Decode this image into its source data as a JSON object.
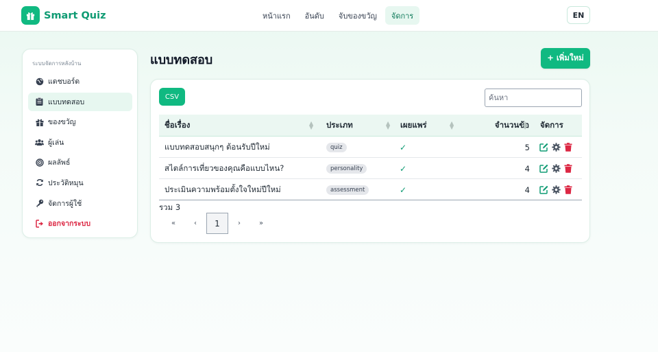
{
  "app": {
    "name": "Smart Quiz"
  },
  "topnav": [
    {
      "label": "หน้าแรก",
      "active": false
    },
    {
      "label": "อันดับ",
      "active": false
    },
    {
      "label": "จับของขวัญ",
      "active": false
    },
    {
      "label": "จัดการ",
      "active": true
    }
  ],
  "lang_button": "EN",
  "sidebar": {
    "heading": "ระบบจัดการหลังบ้าน",
    "items": [
      {
        "label": "แดชบอร์ด",
        "icon": "globe-icon",
        "active": false
      },
      {
        "label": "แบบทดสอบ",
        "icon": "clipboard-icon",
        "active": true
      },
      {
        "label": "ของขวัญ",
        "icon": "gift-icon",
        "active": false
      },
      {
        "label": "ผู้เล่น",
        "icon": "users-icon",
        "active": false
      },
      {
        "label": "ผลลัพธ์",
        "icon": "target-icon",
        "active": false
      },
      {
        "label": "ประวัติหมุน",
        "icon": "refresh-icon",
        "active": false
      },
      {
        "label": "จัดการผู้ใช้",
        "icon": "key-icon",
        "active": false
      },
      {
        "label": "ออกจากระบบ",
        "icon": "logout-icon",
        "active": false
      }
    ]
  },
  "page": {
    "title": "แบบทดสอบ",
    "add_button": "+ เพิ่มใหม่",
    "csv_button": "CSV",
    "search_placeholder": "ค้นหา"
  },
  "table": {
    "columns": [
      "ชื่อเรื่อง",
      "ประเภท",
      "เผยแพร่",
      "จำนวนข้อ",
      "จัดการ"
    ],
    "rows": [
      {
        "title": "แบบทดสอบสนุกๆ ต้อนรับปีใหม่",
        "type": "quiz",
        "published": "✓",
        "count": "5"
      },
      {
        "title": "สไตล์การเที่ยวของคุณคือแบบไหน?",
        "type": "personality",
        "published": "✓",
        "count": "4"
      },
      {
        "title": "ประเมินความพร้อมตั้งใจใหม่ปีใหม่",
        "type": "assessment",
        "published": "✓",
        "count": "4"
      }
    ],
    "total": "รวม 3"
  },
  "pagination": {
    "first": "«",
    "prev": "‹",
    "current": "1",
    "next": "›",
    "last": "»"
  },
  "colors": {
    "accent": "#10b981",
    "danger": "#dc2743",
    "edit": "#0f9b73",
    "gear": "#4b5563"
  }
}
